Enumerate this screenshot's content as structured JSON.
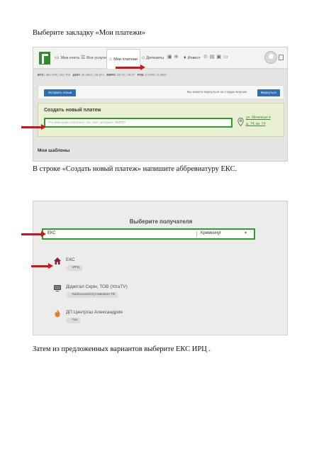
{
  "doc": {
    "step1": "Выберите закладку «Мои платежи»",
    "step2": "В строке «Создать новый платеж» напишите аббревиатуру ЕКС.",
    "step3": "Затем из предложенных вариантов выберите  ЕКС ИРЦ ."
  },
  "screen1": {
    "nav": {
      "tabs": [
        {
          "label": "Мои счета",
          "icon": "wallet-icon"
        },
        {
          "label": "Все услуги",
          "icon": "list-icon"
        },
        {
          "label": "Мои платежи",
          "icon": "home-icon"
        },
        {
          "label": "Депозиты",
          "icon": "bank-icon"
        },
        {
          "label": "Инвест",
          "icon": "coins-icon"
        }
      ]
    },
    "rates": {
      "btc_label": "BTC:",
      "btc_value": "384.709 | 441.703",
      "usd_label": "ДОЛ:",
      "usd_value": "25.2651 | 25.974",
      "eur_label": "ЕВРО:",
      "eur_value": "28.70 | 29.67",
      "rub_label": "РУБ:",
      "rub_value": "0.3780 | 0.3900"
    },
    "feedback_button": "Оставить отзыв",
    "old_version_text": "Вы можете вернуться на старую версию",
    "return_button": "Вернуться",
    "create_title": "Создать новый платеж",
    "create_placeholder": "Что вам нужно оплатить: газ, свет, интернет, ОКПО?",
    "address_line1": "ул. Мечетная",
    "address_line2": "д. 74, кв. 74",
    "templates_title": "Мои шаблоны"
  },
  "screen2": {
    "title": "Выберите получателя",
    "query": "ЕКС",
    "city": "Кременчуг",
    "results": [
      {
        "name": "ЕКС",
        "tag": "ИРЦ",
        "icon": "house-icon"
      },
      {
        "name": "Діджітал Скрін, ТОВ (XtraTV)",
        "tag": "Кабельное/спутниковое ТВ",
        "icon": "tv-icon"
      },
      {
        "name": "ДП Центргаз Александрия",
        "tag": "Газ",
        "icon": "flame-icon"
      }
    ]
  },
  "colors": {
    "accent_green": "#2f9e2f",
    "arrow_red": "#d0141b",
    "button_blue": "#2f6fb0"
  }
}
